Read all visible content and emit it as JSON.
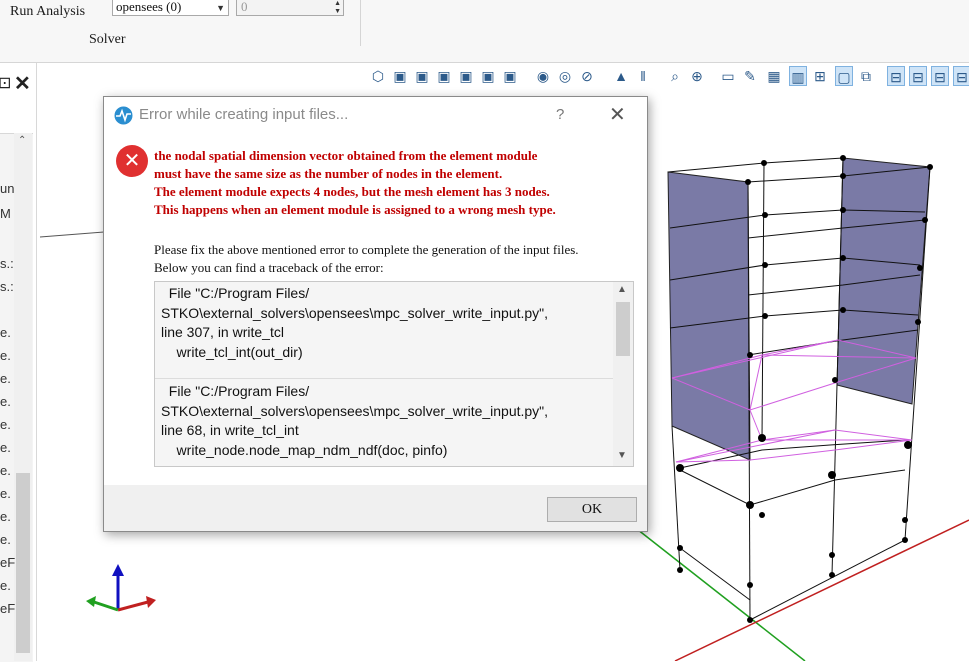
{
  "ribbon": {
    "run_analysis_label": "Run Analysis",
    "solver_select_value": "opensees (0)",
    "spin_value": "0",
    "group_label": "Solver"
  },
  "left_panel": {
    "items": [
      "un",
      "M",
      "s.:",
      "s.:",
      "e.",
      "e.",
      "e.",
      "e.",
      "e.",
      "e.",
      "e.",
      "e.",
      "e.",
      "e.",
      "eF",
      "e.",
      "eF"
    ]
  },
  "dialog": {
    "title": "Error while creating input files...",
    "help_label": "?",
    "close_label": "✕",
    "error_lines": [
      "the nodal spatial dimension vector obtained from the element module",
      "must have the same size as the number of nodes in the element.",
      "The element module expects 4 nodes, but the mesh element has 3 nodes.",
      "This happens when an element module is assigned to a wrong mesh type."
    ],
    "info_lines": [
      "Please fix the above mentioned error to complete the generation of the input files.",
      "Below you can find a traceback of the error:"
    ],
    "traceback": [
      {
        "lines": [
          "  File \"C:/Program Files/",
          "STKO\\external_solvers\\opensees\\mpc_solver_write_input.py\",",
          "line 307, in write_tcl",
          "    write_tcl_int(out_dir)"
        ]
      },
      {
        "lines": [
          "  File \"C:/Program Files/",
          "STKO\\external_solvers\\opensees\\mpc_solver_write_input.py\",",
          "line 68, in write_tcl_int",
          "    write_node.node_map_ndm_ndf(doc, pinfo)"
        ]
      }
    ],
    "ok_label": "OK"
  },
  "colors": {
    "error_text": "#c00000",
    "error_icon": "#e03030",
    "shell_fill": "#7a7aa6",
    "mesh_magenta": "#d060e0",
    "axis_green": "#20a020",
    "axis_red": "#c02020",
    "axis_blue": "#1010c0"
  },
  "toolbar": {
    "icons": [
      "cube-iso-icon",
      "cube-front-icon",
      "cube-back-icon",
      "cube-left-icon",
      "cube-right-icon",
      "cube-top-icon",
      "cube-bottom-icon",
      "eye-icon",
      "eye-outline-icon",
      "eye-hide-icon",
      "triangle-icon",
      "pause-bars-icon",
      "zoom-fit-icon",
      "zoom-icon",
      "screen-icon",
      "pen-icon",
      "grid-icon",
      "ruler-icon",
      "grid-select-icon",
      "window-icon",
      "window-edit-icon",
      "view-1-icon",
      "view-2-icon",
      "view-3-icon",
      "view-4-icon"
    ]
  }
}
